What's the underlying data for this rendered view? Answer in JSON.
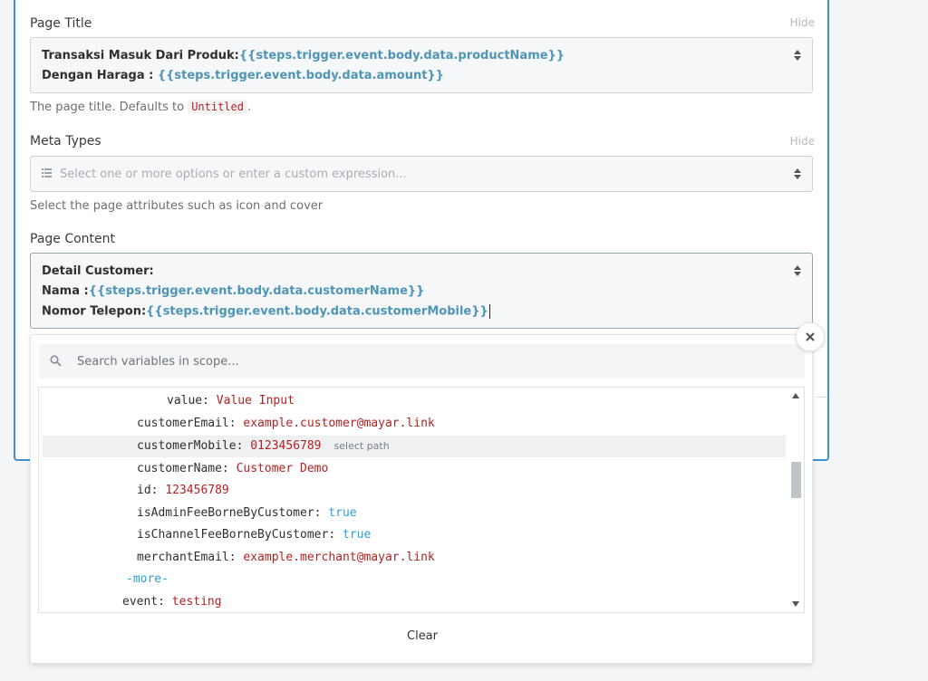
{
  "page_title": {
    "label": "Page Title",
    "hide": "Hide",
    "line1_prefix": "Transaksi Masuk Dari Produk:",
    "line1_expr": "{{steps.trigger.event.body.data.productName}}",
    "line2_prefix": "Dengan Haraga : ",
    "line2_expr": "{{steps.trigger.event.body.data.amount}}",
    "help_prefix": "The page title. Defaults to ",
    "help_code": "Untitled",
    "help_suffix": "."
  },
  "meta_types": {
    "label": "Meta Types",
    "hide": "Hide",
    "placeholder": "Select one or more options or enter a custom expression...",
    "help": "Select the page attributes such as icon and cover"
  },
  "page_content": {
    "label": "Page Content",
    "line1": "Detail Customer:",
    "line2_prefix": "Nama :",
    "line2_expr": "{{steps.trigger.event.body.data.customerName}}",
    "line3_prefix": "Nomor Telepon:",
    "line3_expr": "{{steps.trigger.event.body.data.customerMobile}}"
  },
  "variables_panel": {
    "search_placeholder": "Search variables in scope...",
    "select_path": "select path",
    "more": "-more-",
    "clear": "Clear",
    "rows": [
      {
        "key": "value",
        "sep": ": ",
        "value": "Value Input"
      },
      {
        "key": "customerEmail",
        "sep": ": ",
        "value": "example.customer@mayar.link"
      },
      {
        "key": "customerMobile",
        "sep": ": ",
        "value": "0123456789"
      },
      {
        "key": "customerName",
        "sep": ": ",
        "value": "Customer Demo"
      },
      {
        "key": "id",
        "sep": ": ",
        "value": "123456789"
      },
      {
        "key": "isAdminFeeBorneByCustomer",
        "sep": ": ",
        "value": "true"
      },
      {
        "key": "isChannelFeeBorneByCustomer",
        "sep": ": ",
        "value": "true"
      },
      {
        "key": "merchantEmail",
        "sep": ": ",
        "value": "example.merchant@mayar.link"
      },
      {
        "key": "event",
        "sep": ": ",
        "value": "testing"
      }
    ]
  },
  "colors": {
    "accent_border": "#3f8fd2",
    "expression": "#4f95b5",
    "string_value": "#b32222",
    "boolean_value": "#2a9fd8"
  }
}
